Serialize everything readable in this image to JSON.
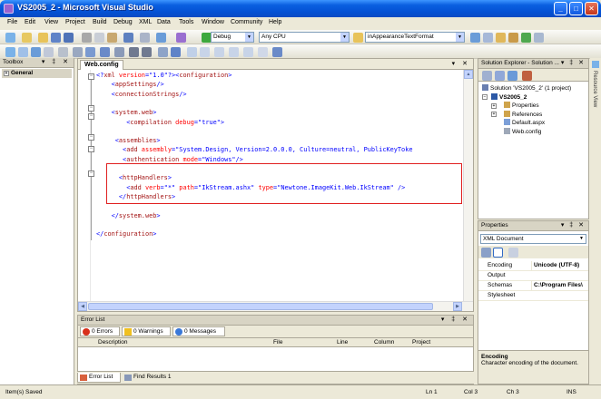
{
  "window": {
    "title": "VS2005_2 - Microsoft Visual Studio",
    "min": "_",
    "max": "□",
    "close": "✕"
  },
  "menu": [
    "File",
    "Edit",
    "View",
    "Project",
    "Build",
    "Debug",
    "XML",
    "Data",
    "Tools",
    "Window",
    "Community",
    "Help"
  ],
  "toolbar": {
    "config": "Debug",
    "platform": "Any CPU",
    "find": "inAppearanceTextFormat"
  },
  "toolbox": {
    "title": "Toolbox",
    "pin": "▾ ‡ ✕",
    "group": "General"
  },
  "editor": {
    "tab": "Web.config",
    "tab_buttons": "▾ ✕",
    "lines": [
      {
        "parts": [
          [
            "blue",
            "<?"
          ],
          [
            "brown",
            "xml"
          ],
          [
            "red",
            " version"
          ],
          [
            "blue",
            "=\""
          ],
          [
            "blue",
            "1.0"
          ],
          [
            "blue",
            "\"?><"
          ],
          [
            "brown",
            "configuration"
          ],
          [
            "blue",
            ">"
          ]
        ]
      },
      {
        "parts": [
          [
            "blue",
            "    <"
          ],
          [
            "brown",
            "appSettings"
          ],
          [
            "blue",
            "/>"
          ]
        ]
      },
      {
        "parts": [
          [
            "blue",
            "    <"
          ],
          [
            "brown",
            "connectionStrings"
          ],
          [
            "blue",
            "/>"
          ]
        ]
      },
      {
        "parts": []
      },
      {
        "parts": [
          [
            "blue",
            "    <"
          ],
          [
            "brown",
            "system.web"
          ],
          [
            "blue",
            ">"
          ]
        ]
      },
      {
        "parts": [
          [
            "blue",
            "        <"
          ],
          [
            "brown",
            "compilation"
          ],
          [
            "red",
            " debug"
          ],
          [
            "blue",
            "=\"true\">"
          ]
        ]
      },
      {
        "parts": []
      },
      {
        "parts": [
          [
            "blue",
            "     <"
          ],
          [
            "brown",
            "assemblies"
          ],
          [
            "blue",
            ">"
          ]
        ]
      },
      {
        "parts": [
          [
            "blue",
            "       <"
          ],
          [
            "brown",
            "add"
          ],
          [
            "red",
            " assembly"
          ],
          [
            "blue",
            "=\"System.Design, Version=2.0.0.0, Culture=neutral, PublicKeyToke"
          ]
        ]
      },
      {
        "parts": [
          [
            "blue",
            "       <"
          ],
          [
            "brown",
            "authentication"
          ],
          [
            "red",
            " mode"
          ],
          [
            "blue",
            "=\"Windows\"/>"
          ]
        ]
      },
      {
        "parts": []
      },
      {
        "parts": [
          [
            "blue",
            "      <"
          ],
          [
            "brown",
            "httpHandlers"
          ],
          [
            "blue",
            ">"
          ]
        ]
      },
      {
        "parts": [
          [
            "blue",
            "        <"
          ],
          [
            "brown",
            "add"
          ],
          [
            "red",
            " verb"
          ],
          [
            "blue",
            "=\"*\""
          ],
          [
            "red",
            " path"
          ],
          [
            "blue",
            "=\"IkStream.ashx\""
          ],
          [
            "red",
            " type"
          ],
          [
            "blue",
            "=\"Newtone.ImageKit.Web.IkStream\" />"
          ]
        ]
      },
      {
        "parts": [
          [
            "blue",
            "      </"
          ],
          [
            "brown",
            "httpHandlers"
          ],
          [
            "blue",
            ">"
          ]
        ]
      },
      {
        "parts": []
      },
      {
        "parts": [
          [
            "blue",
            "    </"
          ],
          [
            "brown",
            "system.web"
          ],
          [
            "blue",
            ">"
          ]
        ]
      },
      {
        "parts": []
      },
      {
        "parts": [
          [
            "blue",
            "</"
          ],
          [
            "brown",
            "configuration"
          ],
          [
            "blue",
            ">"
          ]
        ]
      }
    ]
  },
  "errorlist": {
    "title": "Error List",
    "pin": "▾ ‡ ✕",
    "errors": "0 Errors",
    "warnings": "0 Warnings",
    "messages": "0 Messages",
    "columns": [
      "Description",
      "File",
      "Line",
      "Column",
      "Project"
    ]
  },
  "bottom_tabs": [
    "Error List",
    "Find Results 1"
  ],
  "solution": {
    "title": "Solution Explorer - Solution ...",
    "pin": "▾ ‡ ✕",
    "items": [
      {
        "label": "Solution 'VS2005_2' (1 project)",
        "indent": 0,
        "bold": false,
        "color": "#6a7fb0"
      },
      {
        "label": "VS2005_2",
        "indent": 1,
        "bold": true,
        "color": "#2c59a6"
      },
      {
        "label": "Properties",
        "indent": 2,
        "bold": false,
        "color": "#cfa44c"
      },
      {
        "label": "References",
        "indent": 2,
        "bold": false,
        "color": "#cfa44c"
      },
      {
        "label": "Default.aspx",
        "indent": 2,
        "bold": false,
        "color": "#7c9fd8"
      },
      {
        "label": "Web.config",
        "indent": 2,
        "bold": false,
        "color": "#9ea8b8"
      }
    ]
  },
  "properties": {
    "title": "Properties",
    "pin": "▾ ‡ ✕",
    "object": "XML Document",
    "rows": [
      {
        "k": "Encoding",
        "v": "Unicode (UTF-8)"
      },
      {
        "k": "Output",
        "v": ""
      },
      {
        "k": "Schemas",
        "v": "C:\\Program Files\\"
      },
      {
        "k": "Stylesheet",
        "v": ""
      }
    ],
    "desc_title": "Encoding",
    "desc_text": "Character encoding of the document."
  },
  "resource_view": "Resource View",
  "status": {
    "text": "Item(s) Saved",
    "ln": "Ln 1",
    "col": "Col 3",
    "ch": "Ch 3",
    "ins": "INS"
  }
}
